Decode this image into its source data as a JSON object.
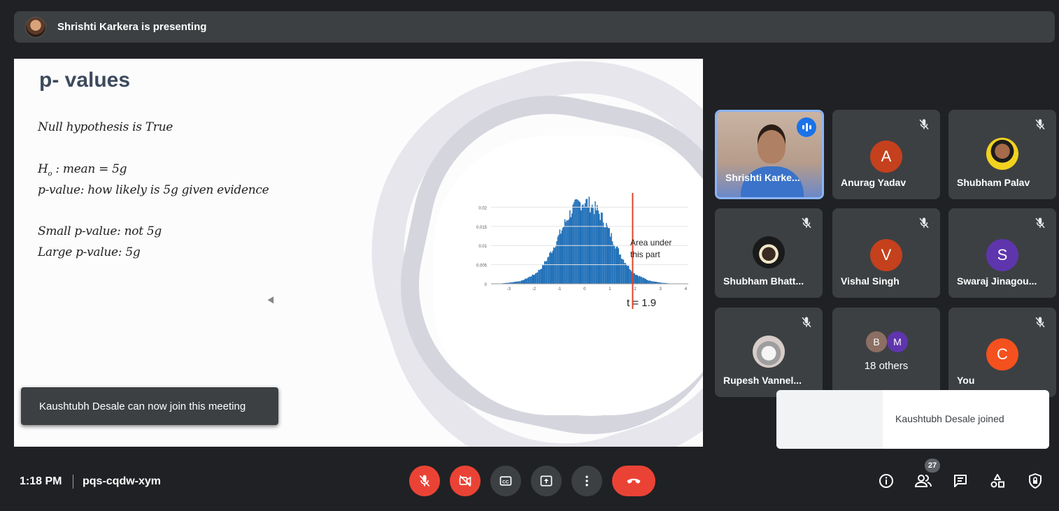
{
  "presenting_bar": {
    "text": "Shrishti Karkera is presenting"
  },
  "slide": {
    "title": "p- values",
    "line1": "Null hypothesis is True",
    "h0_h": "H",
    "h0_sub": "o",
    "h0_rest": ": mean = 5g",
    "line3": "p-value: how likely is 5g given evidence",
    "line4": "Small p-value: not 5g",
    "line5": "Large p-value: 5g",
    "annotation_line1": "Area under",
    "annotation_line2": "this part",
    "t_label": "t = 1.9"
  },
  "chart_data": {
    "type": "bar",
    "title": "",
    "xlabel": "",
    "ylabel": "",
    "x_ticks": [
      "-3",
      "-2",
      "-1",
      "0",
      "1",
      "2",
      "3",
      "4"
    ],
    "y_ticks": [
      "0.02",
      "0.015",
      "0.01",
      "0.005",
      "0"
    ],
    "xlim": [
      -3.7,
      4.1
    ],
    "ylim": [
      0,
      0.023
    ],
    "bins_x": [
      -3.0,
      -2.5,
      -2.0,
      -1.75,
      -1.5,
      -1.25,
      -1.0,
      -0.75,
      -0.5,
      -0.25,
      0.0,
      0.25,
      0.5,
      0.75,
      1.0,
      1.25,
      1.5,
      1.75,
      2.0,
      2.5,
      3.0
    ],
    "values": [
      0.0003,
      0.0008,
      0.0025,
      0.004,
      0.0065,
      0.0095,
      0.013,
      0.0165,
      0.0195,
      0.021,
      0.0215,
      0.0205,
      0.019,
      0.0165,
      0.013,
      0.0095,
      0.0065,
      0.0042,
      0.0025,
      0.0009,
      0.0003
    ],
    "threshold_x": 1.9,
    "series_color": "#1f6fb8",
    "threshold_color": "#e0442a"
  },
  "toast_left": {
    "text": "Kaushtubh Desale can now join this meeting"
  },
  "participants": [
    {
      "name": "Shrishti Karke..."
    },
    {
      "name": "Anurag Yadav",
      "initial": "A",
      "color": "#c5401c"
    },
    {
      "name": "Shubham Palav"
    },
    {
      "name": "Shubham Bhatt..."
    },
    {
      "name": "Vishal Singh",
      "initial": "V",
      "color": "#c5401c"
    },
    {
      "name": "Swaraj Jinagou...",
      "initial": "S",
      "color": "#5f35ae"
    },
    {
      "name": "Rupesh Vannel..."
    },
    {
      "name": "18 others",
      "initial_b": "B",
      "initial_m": "M",
      "color_b": "#8d6e63",
      "color_m": "#5f35ae"
    },
    {
      "name": "You",
      "initial": "C",
      "color": "#f4511e"
    }
  ],
  "toast_right": {
    "text": "Kaushtubh Desale joined"
  },
  "bottom_bar": {
    "time": "1:18 PM",
    "meeting_code": "pqs-cqdw-xym",
    "participant_count": "27",
    "controls": [
      "mic-off-icon",
      "camera-off-icon",
      "captions-icon",
      "present-icon",
      "more-options-icon",
      "leave-call-icon"
    ],
    "right_icons": [
      "info-icon",
      "people-icon",
      "chat-icon",
      "activities-icon",
      "host-controls-icon"
    ],
    "red": "#ea4335"
  }
}
